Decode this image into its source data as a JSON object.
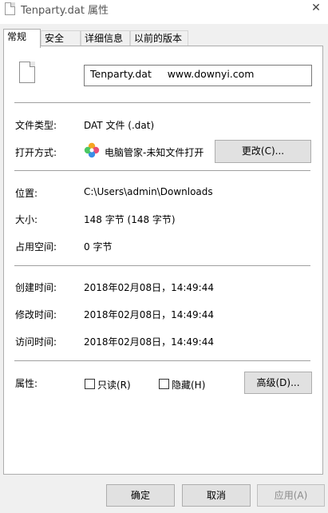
{
  "window": {
    "title": "Tenparty.dat 属性",
    "close_glyph": "✕"
  },
  "tabs": [
    {
      "label": "常规",
      "active": true
    },
    {
      "label": "安全",
      "active": false
    },
    {
      "label": "详细信息",
      "active": false
    },
    {
      "label": "以前的版本",
      "active": false
    }
  ],
  "general": {
    "file_icon": "blank-file-icon",
    "file_name_value": "Tenparty.dat     www.downyi.com",
    "file_type": {
      "label": "文件类型:",
      "value": "DAT 文件 (.dat)"
    },
    "open_with": {
      "label": "打开方式:",
      "app_icon": "pinwheel-app-icon",
      "value": "电脑管家-未知文件打开",
      "change_button": "更改(C)..."
    },
    "location": {
      "label": "位置:",
      "value": "C:\\Users\\admin\\Downloads"
    },
    "size": {
      "label": "大小:",
      "value": "148 字节 (148 字节)"
    },
    "size_on_disk": {
      "label": "占用空间:",
      "value": "0 字节"
    },
    "created": {
      "label": "创建时间:",
      "value": "2018年02月08日，14:49:44"
    },
    "modified": {
      "label": "修改时间:",
      "value": "2018年02月08日，14:49:44"
    },
    "accessed": {
      "label": "访问时间:",
      "value": "2018年02月08日，14:49:44"
    },
    "attributes": {
      "label": "属性:",
      "readonly_label": "只读(R)",
      "readonly_checked": false,
      "hidden_label": "隐藏(H)",
      "hidden_checked": false,
      "advanced_button": "高级(D)..."
    }
  },
  "footer": {
    "ok": "确定",
    "cancel": "取消",
    "apply": "应用(A)"
  },
  "colors": {
    "window_bg": "#f0f0f0",
    "panel_bg": "#ffffff",
    "border": "#adadad",
    "button_bg": "#e1e1e1",
    "disabled_text": "#8a8a8a"
  }
}
